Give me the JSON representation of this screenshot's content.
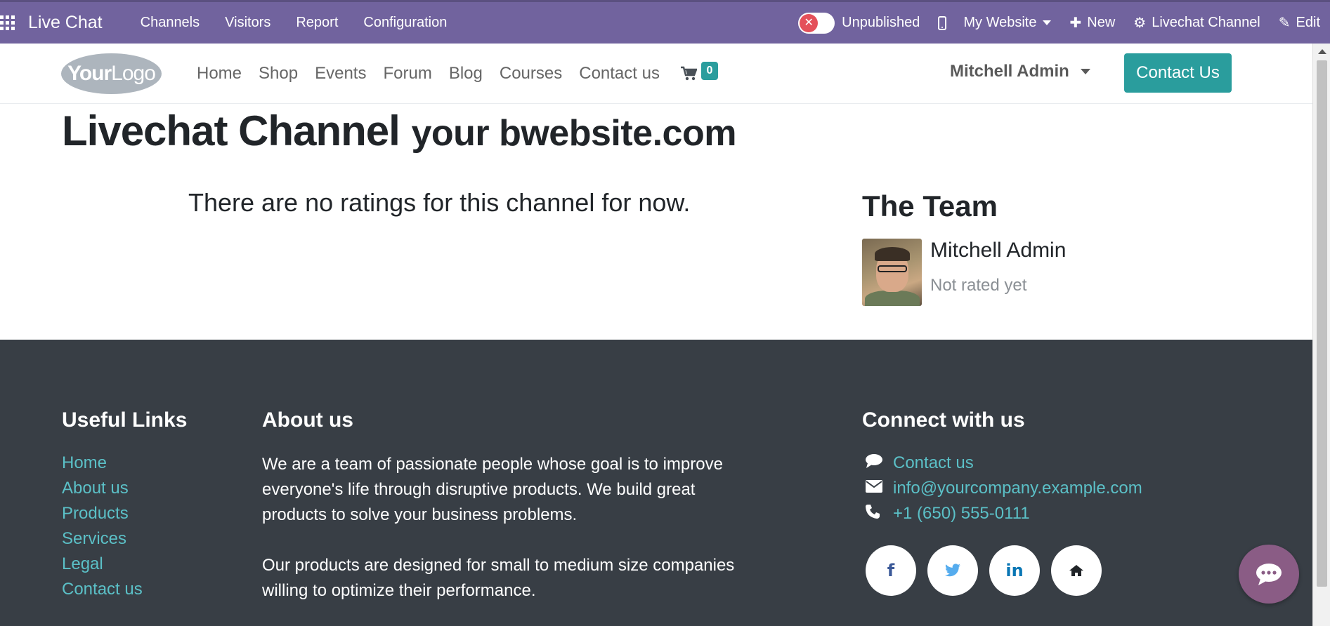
{
  "adminbar": {
    "app_title": "Live Chat",
    "menu": [
      "Channels",
      "Visitors",
      "Report",
      "Configuration"
    ],
    "publish_status": "Unpublished",
    "website": "My Website",
    "new_label": "New",
    "channel_label": "Livechat Channel",
    "edit_label": "Edit",
    "color": "#71639e"
  },
  "header": {
    "logo_text_bold": "Your",
    "logo_text": "Logo",
    "nav": [
      "Home",
      "Shop",
      "Events",
      "Forum",
      "Blog",
      "Courses",
      "Contact us"
    ],
    "cart_count": "0",
    "user": "Mitchell Admin",
    "cta": "Contact Us",
    "accent_color": "#2a9d9d"
  },
  "main": {
    "title_main": "Livechat Channel",
    "title_sub": "your bwebsite.com",
    "no_ratings": "There are no ratings for this channel for now.",
    "team_title": "The Team",
    "members": [
      {
        "name": "Mitchell Admin",
        "status": "Not rated yet"
      }
    ]
  },
  "footer": {
    "useful_links_title": "Useful Links",
    "useful_links": [
      "Home",
      "About us",
      "Products",
      "Services",
      "Legal",
      "Contact us"
    ],
    "about_title": "About us",
    "about_p1": "We are a team of passionate people whose goal is to improve everyone's life through disruptive products. We build great products to solve your business problems.",
    "about_p2": "Our products are designed for small to medium size companies willing to optimize their performance.",
    "connect_title": "Connect with us",
    "connect": [
      {
        "icon": "comment-icon",
        "text": "Contact us"
      },
      {
        "icon": "envelope-icon",
        "text": "info@yourcompany.example.com"
      },
      {
        "icon": "phone-icon",
        "text": "+1 (650) 555-0111"
      }
    ],
    "socials": [
      {
        "icon": "facebook-icon",
        "glyph": "f",
        "color": "#3b5998"
      },
      {
        "icon": "twitter-icon",
        "glyph": "🐦",
        "color": "#55acee"
      },
      {
        "icon": "linkedin-icon",
        "glyph": "in",
        "color": "#0976b4"
      },
      {
        "icon": "home-icon",
        "glyph": "⌂",
        "color": "#212529"
      }
    ],
    "link_color": "#5bc0c7",
    "bg_color": "#383e45"
  }
}
